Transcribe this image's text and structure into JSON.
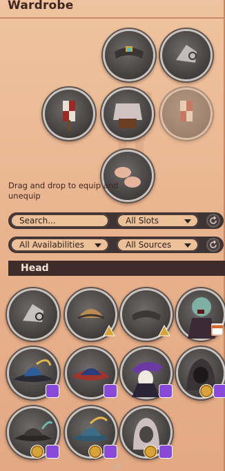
{
  "header": {
    "title": "Wardrobe"
  },
  "equip": {
    "hint": "Drag and drop to equip and unequip"
  },
  "filters": {
    "search_placeholder": "Search...",
    "slots_label": "All Slots",
    "availability_label": "All Availabilities",
    "sources_label": "All Sources"
  },
  "section": {
    "label": "Head"
  },
  "items": [
    {
      "name": "default-hood",
      "badge": "none"
    },
    {
      "name": "tan-helm",
      "badge": "gold"
    },
    {
      "name": "iron-circlet",
      "badge": "gold"
    },
    {
      "name": "ghoul-mask",
      "badge": "calendar"
    },
    {
      "name": "blue-feather-hat",
      "badge": "twitch"
    },
    {
      "name": "red-pirate-hat",
      "badge": "twitch"
    },
    {
      "name": "jester-hat",
      "badge": "twitch"
    },
    {
      "name": "dark-hood",
      "badge": "coin+twitch"
    },
    {
      "name": "black-feather-hat",
      "badge": "coin+twitch"
    },
    {
      "name": "teal-feather-hat",
      "badge": "coin+twitch"
    },
    {
      "name": "grey-cowl",
      "badge": "coin+twitch"
    }
  ],
  "colors": {
    "accent": "#3f2c2a",
    "panel": "#e8b48e",
    "twitch": "#8a4ad8",
    "coin": "#d8a43a"
  }
}
